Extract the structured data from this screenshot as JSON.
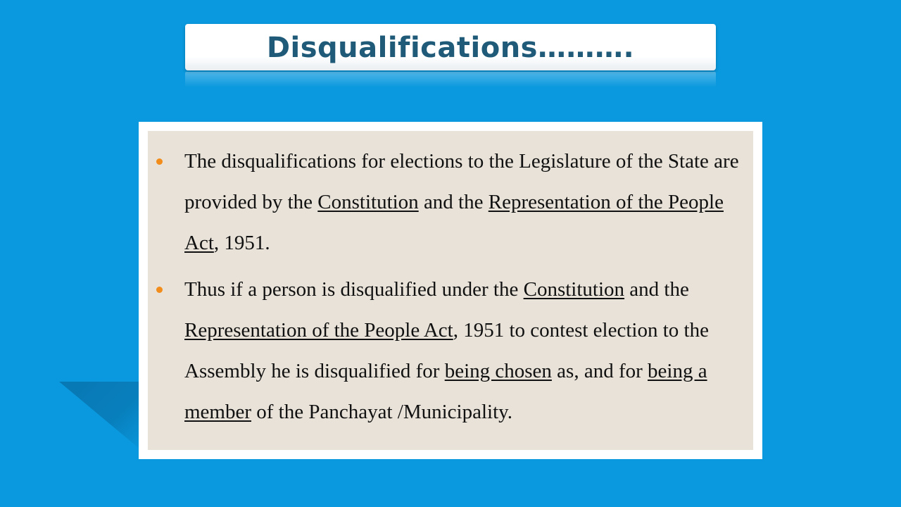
{
  "slide": {
    "title": "Disqualifications……….",
    "bullets": [
      {
        "segments": [
          {
            "text": "The disqualifications for elections to the Legislature of the State are provided by the ",
            "underline": false
          },
          {
            "text": "Constitution",
            "underline": true
          },
          {
            "text": " and the ",
            "underline": false
          },
          {
            "text": "Representation of the People Act",
            "underline": true
          },
          {
            "text": ", 1951.",
            "underline": false
          }
        ]
      },
      {
        "segments": [
          {
            "text": "Thus if a person is disqualified under the ",
            "underline": false
          },
          {
            "text": "Constitution",
            "underline": true
          },
          {
            "text": " and the ",
            "underline": false
          },
          {
            "text": "Representation of the People Act",
            "underline": true
          },
          {
            "text": ", 1951 to contest election to the Assembly he is disqualified for ",
            "underline": false
          },
          {
            "text": "being chosen",
            "underline": true
          },
          {
            "text": " as, and for ",
            "underline": false
          },
          {
            "text": "being a member",
            "underline": true
          },
          {
            "text": " of the Panchayat /Municipality.",
            "underline": false
          }
        ]
      }
    ]
  },
  "colors": {
    "background": "#0a99de",
    "title_text": "#1f5a78",
    "card_fill": "#e8e2d8",
    "bullet": "#f28c1b"
  }
}
